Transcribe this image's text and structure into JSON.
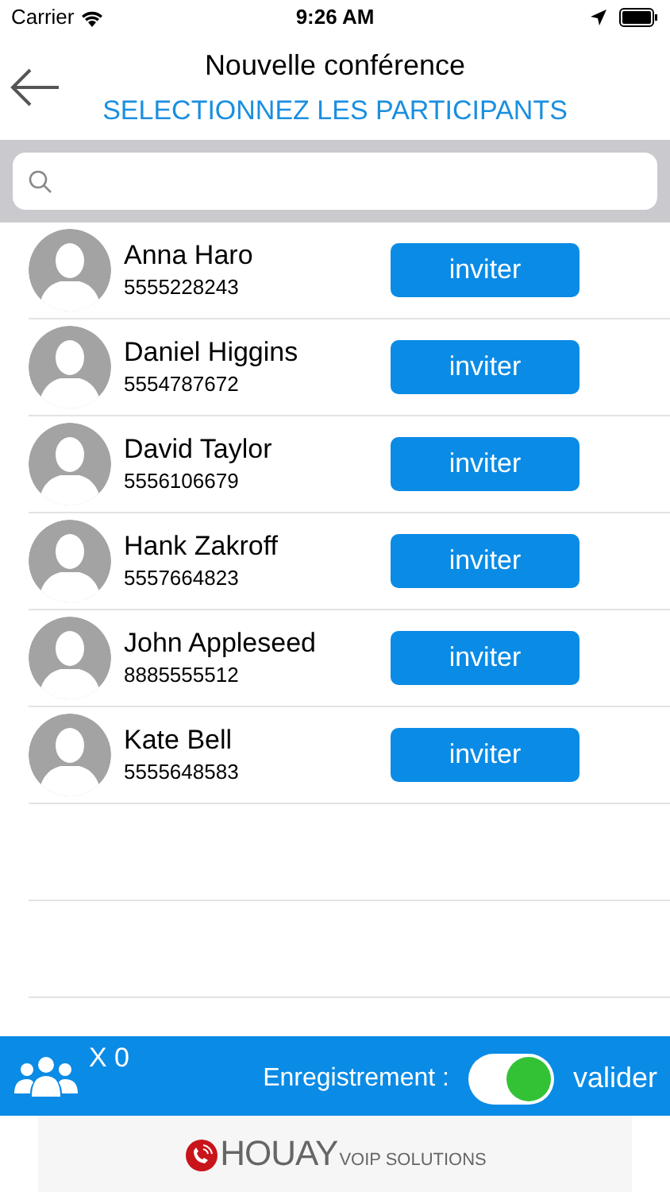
{
  "status_bar": {
    "carrier": "Carrier",
    "time": "9:26 AM"
  },
  "header": {
    "title": "Nouvelle conférence",
    "subtitle": "SELECTIONNEZ LES PARTICIPANTS"
  },
  "contacts": [
    {
      "name": "Anna Haro",
      "phone": "5555228243",
      "action": "inviter"
    },
    {
      "name": "Daniel Higgins",
      "phone": "5554787672",
      "action": "inviter"
    },
    {
      "name": "David Taylor",
      "phone": "5556106679",
      "action": "inviter"
    },
    {
      "name": "Hank Zakroff",
      "phone": "5557664823",
      "action": "inviter"
    },
    {
      "name": "John Appleseed",
      "phone": "8885555512",
      "action": "inviter"
    },
    {
      "name": "Kate Bell",
      "phone": "5555648583",
      "action": "inviter"
    }
  ],
  "bottom_bar": {
    "count": "X 0",
    "recording_label": "Enregistrement :",
    "recording_on": true,
    "submit": "valider"
  },
  "footer": {
    "brand": "HOUAY",
    "tagline": "VOIP SOLUTIONS"
  }
}
